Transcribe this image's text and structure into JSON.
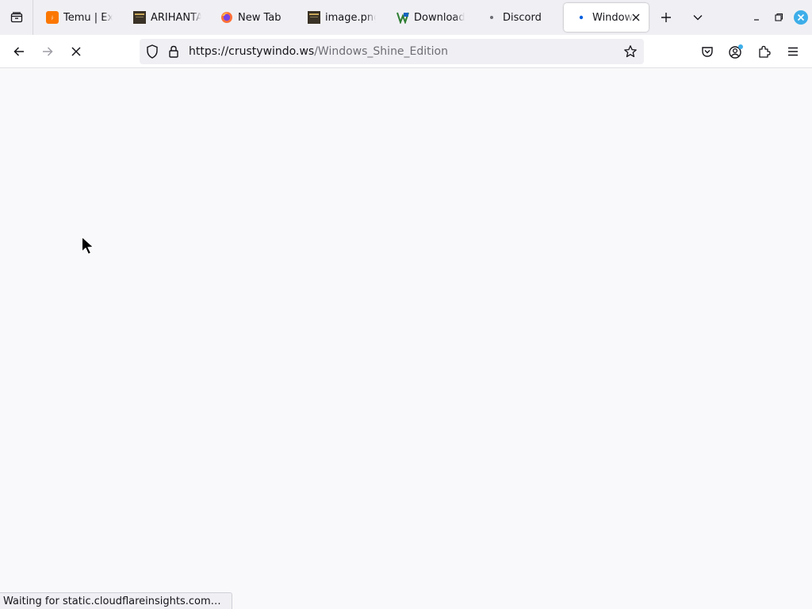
{
  "tabs": [
    {
      "label": "Temu | Ex",
      "favicon": "temu-icon",
      "active": false
    },
    {
      "label": "ARIHANTA",
      "favicon": "book-cover-icon",
      "active": false
    },
    {
      "label": "New Tab",
      "favicon": "firefox-icon",
      "active": false
    },
    {
      "label": "image.png",
      "favicon": "image-thumbnail-icon",
      "active": false
    },
    {
      "label": "Download",
      "favicon": "download-site-icon",
      "active": false
    },
    {
      "label": "Discord",
      "favicon": "loading-dot-icon",
      "active": false
    },
    {
      "label": "Window",
      "favicon": "loading-dot-icon",
      "active": true
    }
  ],
  "urlbar": {
    "url_host": "https://crustywindo.ws",
    "url_path": "/Windows_Shine_Edition"
  },
  "status": {
    "text": "Waiting for static.cloudflareinsights.com…"
  },
  "colors": {
    "accent": "#0060df",
    "close_window": "#3daee9",
    "temu_orange": "#fb7701"
  }
}
